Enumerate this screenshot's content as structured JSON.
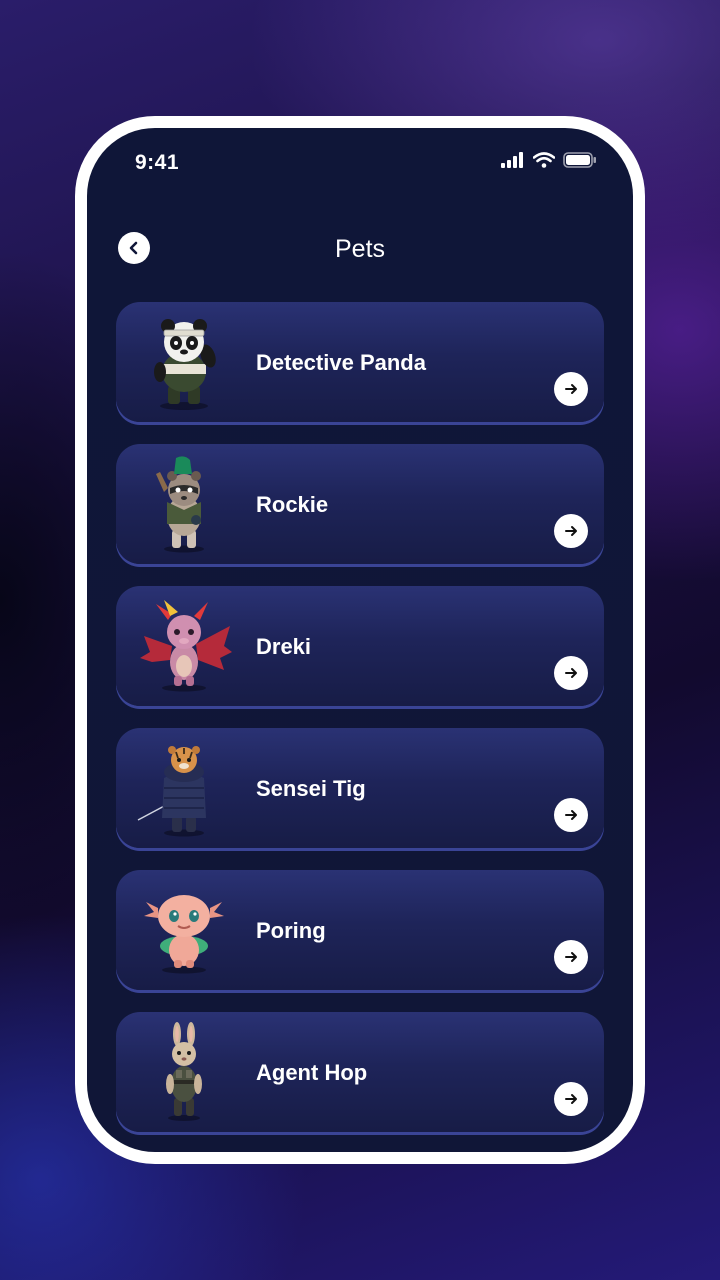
{
  "status_bar": {
    "time": "9:41",
    "icons": [
      "signal-icon",
      "wifi-icon",
      "battery-icon"
    ]
  },
  "header": {
    "title": "Pets",
    "back_icon": "chevron-left-icon"
  },
  "colors": {
    "screen_bg": "#0f1638",
    "card_top": "#2a3274",
    "card_bottom": "#171c46",
    "card_edge": "#3a4496",
    "frame": "#ffffff"
  },
  "pets": [
    {
      "name": "Detective Panda",
      "icon": "panda-icon"
    },
    {
      "name": "Rockie",
      "icon": "raccoon-icon"
    },
    {
      "name": "Dreki",
      "icon": "dragon-icon"
    },
    {
      "name": "Sensei Tig",
      "icon": "tiger-icon"
    },
    {
      "name": "Poring",
      "icon": "axolotl-icon"
    },
    {
      "name": "Agent Hop",
      "icon": "rabbit-icon"
    }
  ]
}
